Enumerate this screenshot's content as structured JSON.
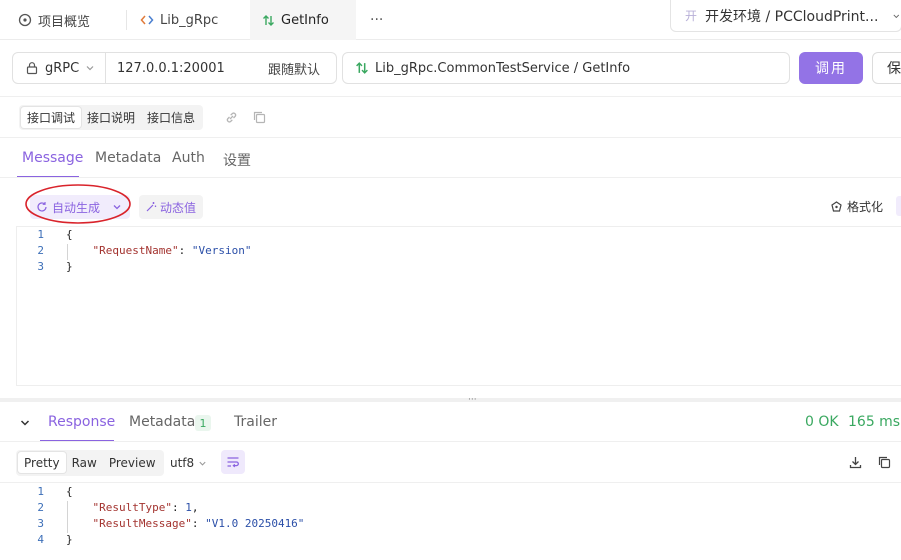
{
  "tabs": [
    {
      "label": "项目概览",
      "icon": "project-overview-icon"
    },
    {
      "label": "Lib_gRpc",
      "icon": "code-brackets-icon"
    },
    {
      "label": "GetInfo",
      "icon": "grpc-arrows-icon"
    }
  ],
  "more_label": "···",
  "environment": {
    "badge": "开",
    "label": "开发环境 / PCCloudPrint..."
  },
  "request": {
    "protocol": "gRPC",
    "host": "127.0.0.1:20001",
    "host_mode": "跟随默认",
    "method_path": "Lib_gRpc.CommonTestService / GetInfo",
    "invoke_label": "调用",
    "save_label": "保"
  },
  "sub_tabs": [
    "接口调试",
    "接口说明",
    "接口信息"
  ],
  "message_tabs": [
    "Message",
    "Metadata",
    "Auth",
    "设置"
  ],
  "toolbar": {
    "autogen_label": "自动生成",
    "dynamic_label": "动态值",
    "format_label": "格式化"
  },
  "request_body": {
    "lines": [
      "1",
      "2",
      "3"
    ],
    "key": "\"RequestName\"",
    "value": "\"Version\""
  },
  "response": {
    "tabs": [
      "Response",
      "Metadata",
      "Trailer"
    ],
    "metadata_count": "1",
    "status": "0 OK",
    "time": "165 ms",
    "view_modes": [
      "Pretty",
      "Raw",
      "Preview"
    ],
    "encoding": "utf8",
    "lines": [
      "1",
      "2",
      "3",
      "4"
    ],
    "key1": "\"ResultType\"",
    "val1": "1",
    "key2": "\"ResultMessage\"",
    "val2": "\"V1.0 20250416\""
  },
  "colors": {
    "accent": "#8a63e0",
    "invoke_bg": "#9373e6",
    "success": "#3aa860",
    "annotation_ring": "#d9232b"
  }
}
